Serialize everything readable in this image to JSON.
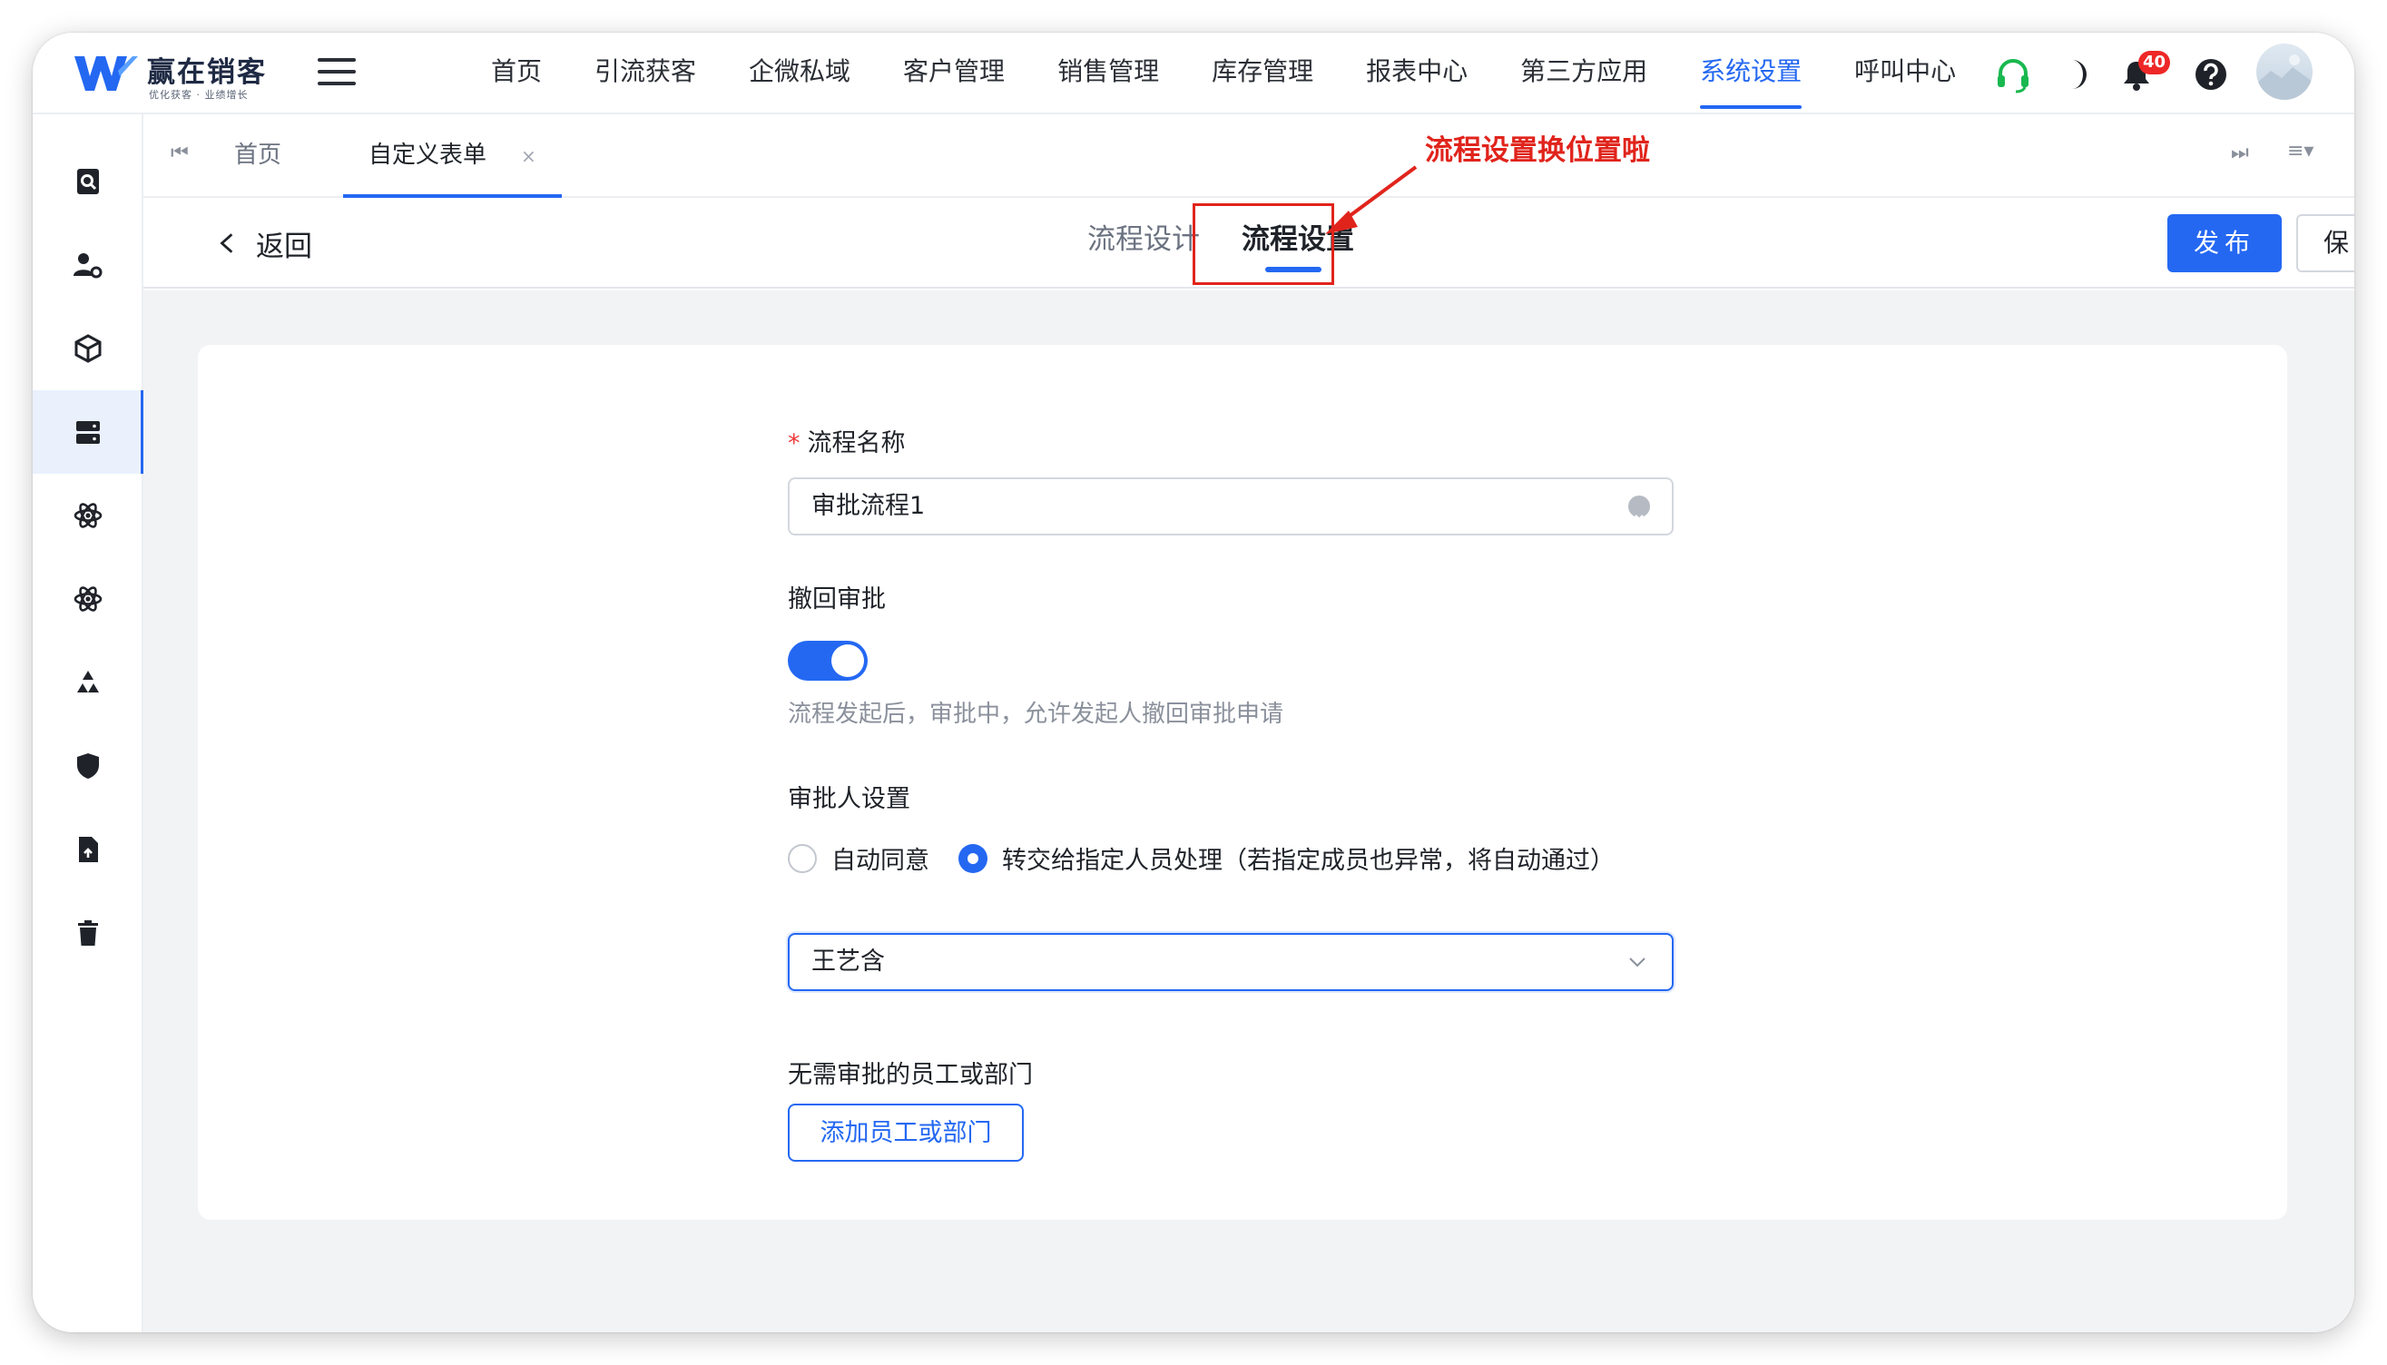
{
  "brand": {
    "name": "赢在销客",
    "slogan": "优化获客 · 业绩增长",
    "accent_color": "#2468f2"
  },
  "top_nav": {
    "items": [
      {
        "label": "首页",
        "active": false
      },
      {
        "label": "引流获客",
        "active": false
      },
      {
        "label": "企微私域",
        "active": false
      },
      {
        "label": "客户管理",
        "active": false
      },
      {
        "label": "销售管理",
        "active": false
      },
      {
        "label": "库存管理",
        "active": false
      },
      {
        "label": "报表中心",
        "active": false
      },
      {
        "label": "第三方应用",
        "active": false
      },
      {
        "label": "系统设置",
        "active": true
      },
      {
        "label": "呼叫中心",
        "active": false
      }
    ],
    "icons": [
      "headset-icon",
      "moon-icon",
      "bell-icon",
      "help-icon"
    ],
    "notification_count": "40"
  },
  "sidebar": {
    "items": [
      {
        "icon": "search-doc-icon",
        "active": false
      },
      {
        "icon": "user-settings-icon",
        "active": false
      },
      {
        "icon": "cube-icon",
        "active": false
      },
      {
        "icon": "server-icon",
        "active": true
      },
      {
        "icon": "atom-icon",
        "active": false
      },
      {
        "icon": "atom-icon",
        "active": false
      },
      {
        "icon": "recycle-icon",
        "active": false
      },
      {
        "icon": "shield-icon",
        "active": false
      },
      {
        "icon": "file-icon",
        "active": false
      },
      {
        "icon": "trash-icon",
        "active": false
      }
    ]
  },
  "tabs": {
    "items": [
      {
        "label": "首页",
        "active": false,
        "closable": false
      },
      {
        "label": "自定义表单",
        "active": true,
        "closable": true
      }
    ],
    "close_glyph": "×"
  },
  "subheader": {
    "back_label": "返回",
    "design_tabs": [
      {
        "label": "流程设计",
        "active": false
      },
      {
        "label": "流程设置",
        "active": true
      }
    ],
    "publish_label": "发布",
    "save_label": "保存",
    "annotation": "流程设置换位置啦"
  },
  "form": {
    "name_label": "流程名称",
    "name_required_mark": "*",
    "name_value": "审批流程1",
    "withdraw_label": "撤回审批",
    "withdraw_enabled": true,
    "withdraw_hint": "流程发起后，审批中，允许发起人撤回审批申请",
    "approver_label": "审批人设置",
    "approver_options": [
      {
        "label": "自动同意",
        "checked": false
      },
      {
        "label": "转交给指定人员处理（若指定成员也异常，将自动通过）",
        "checked": true
      }
    ],
    "approver_selected": "王艺含",
    "exempt_label": "无需审批的员工或部门",
    "exempt_button": "添加员工或部门"
  }
}
